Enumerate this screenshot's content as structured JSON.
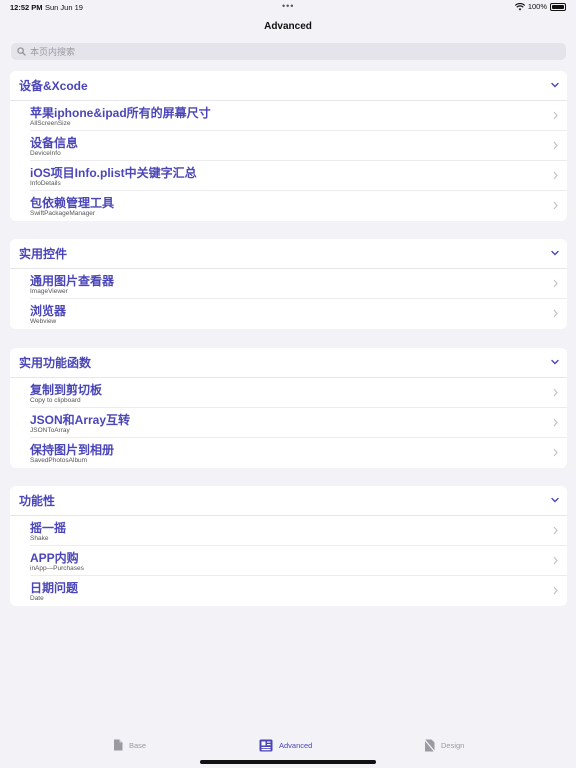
{
  "status": {
    "time": "12:52 PM",
    "date": "Sun Jun 19",
    "battery": "100%"
  },
  "nav": {
    "title": "Advanced"
  },
  "search": {
    "placeholder": "本页内搜索"
  },
  "sections": [
    {
      "title": "设备&Xcode",
      "items": [
        {
          "title": "苹果iphone&ipad所有的屏幕尺寸",
          "subtitle": "AllScreenSize"
        },
        {
          "title": "设备信息",
          "subtitle": "DeviceInfo"
        },
        {
          "title": "iOS项目Info.plist中关键字汇总",
          "subtitle": "InfoDetails"
        },
        {
          "title": "包依赖管理工具",
          "subtitle": "SwiftPackageManager"
        }
      ]
    },
    {
      "title": "实用控件",
      "items": [
        {
          "title": "通用图片查看器",
          "subtitle": "ImageViewer"
        },
        {
          "title": "浏览器",
          "subtitle": "Webview"
        }
      ]
    },
    {
      "title": "实用功能函数",
      "items": [
        {
          "title": "复制到剪切板",
          "subtitle": "Copy to clipboard"
        },
        {
          "title": "JSON和Array互转",
          "subtitle": "JSONToArray"
        },
        {
          "title": "保持图片到相册",
          "subtitle": "SavedPhotosAlbum"
        }
      ]
    },
    {
      "title": "功能性",
      "items": [
        {
          "title": "摇一摇",
          "subtitle": "Shake"
        },
        {
          "title": "APP内购",
          "subtitle": "inApp—Purchases"
        },
        {
          "title": "日期问题",
          "subtitle": "Date"
        }
      ]
    }
  ],
  "tabs": [
    {
      "label": "Base",
      "icon": "document-icon",
      "active": false
    },
    {
      "label": "Advanced",
      "icon": "newspaper-icon",
      "active": true
    },
    {
      "label": "Design",
      "icon": "design-icon",
      "active": false
    }
  ],
  "colors": {
    "accent": "#4b46b8",
    "background": "#f2f2f7",
    "inactive": "#9a9aa0"
  }
}
